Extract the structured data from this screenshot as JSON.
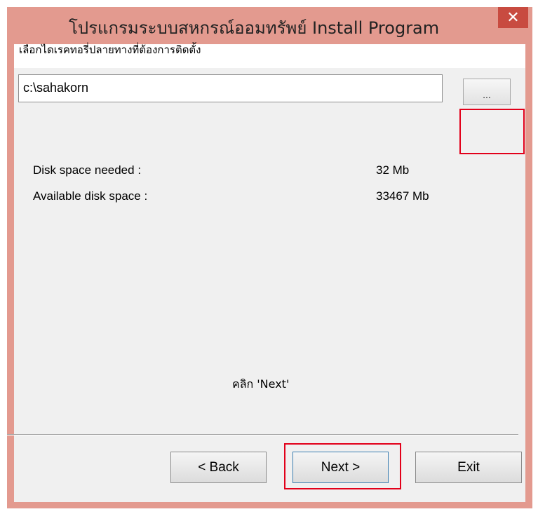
{
  "window": {
    "title": "โปรแกรมระบบสหกรณ์ออมทรัพย์ Install Program",
    "close_glyph": "✕"
  },
  "main": {
    "heading": "เลือกไดเรคทอรี่ปลายทางที่ต้องการติดตั้ง",
    "path_value": "c:\\sahakorn",
    "browse_label": "...",
    "disk_needed_label": "Disk space needed :",
    "disk_needed_value": "32 Mb",
    "available_label": "Available disk space :",
    "available_value": "33467 Mb",
    "hint": "คลิก 'Next'"
  },
  "footer": {
    "back_label": "< Back",
    "next_label": "Next >",
    "exit_label": "Exit"
  },
  "colors": {
    "titlebar": "#e39a8f",
    "close_button": "#c84b40",
    "highlight": "#e2001a",
    "client_bg": "#f0f0f0"
  }
}
